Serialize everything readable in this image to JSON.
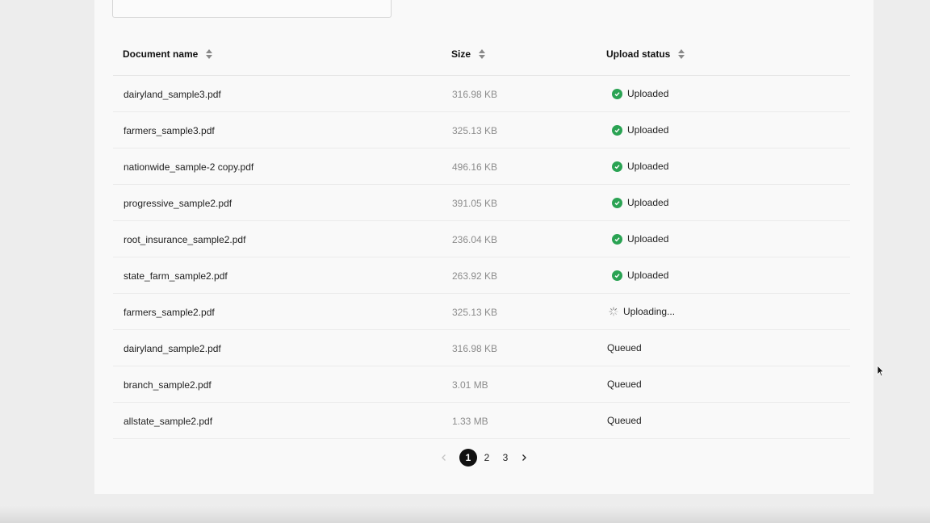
{
  "table": {
    "headers": {
      "name": "Document name",
      "size": "Size",
      "status": "Upload status"
    },
    "rows": [
      {
        "name": "dairyland_sample3.pdf",
        "size": "316.98 KB",
        "status": "Uploaded",
        "state": "done"
      },
      {
        "name": "farmers_sample3.pdf",
        "size": "325.13 KB",
        "status": "Uploaded",
        "state": "done"
      },
      {
        "name": "nationwide_sample-2 copy.pdf",
        "size": "496.16 KB",
        "status": "Uploaded",
        "state": "done"
      },
      {
        "name": "progressive_sample2.pdf",
        "size": "391.05 KB",
        "status": "Uploaded",
        "state": "done"
      },
      {
        "name": "root_insurance_sample2.pdf",
        "size": "236.04 KB",
        "status": "Uploaded",
        "state": "done"
      },
      {
        "name": "state_farm_sample2.pdf",
        "size": "263.92 KB",
        "status": "Uploaded",
        "state": "done"
      },
      {
        "name": "farmers_sample2.pdf",
        "size": "325.13 KB",
        "status": "Uploading...",
        "state": "uploading"
      },
      {
        "name": "dairyland_sample2.pdf",
        "size": "316.98 KB",
        "status": "Queued",
        "state": "queued"
      },
      {
        "name": "branch_sample2.pdf",
        "size": "3.01 MB",
        "status": "Queued",
        "state": "queued"
      },
      {
        "name": "allstate_sample2.pdf",
        "size": "1.33 MB",
        "status": "Queued",
        "state": "queued"
      }
    ]
  },
  "pagination": {
    "pages": [
      "1",
      "2",
      "3"
    ],
    "current": "1",
    "prev_icon": "chevron-left-icon",
    "next_icon": "chevron-right-icon"
  },
  "colors": {
    "success": "#2aa353",
    "active_page": "#111111"
  }
}
